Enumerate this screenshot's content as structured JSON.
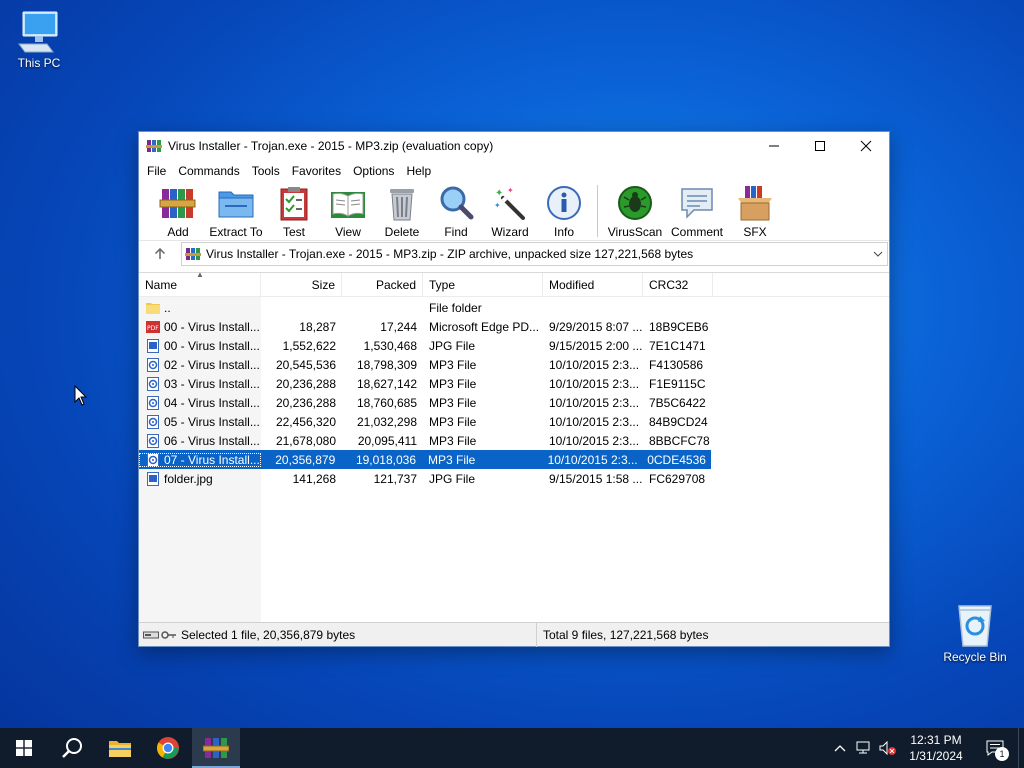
{
  "desktop": {
    "icons": [
      {
        "label": "This PC",
        "icon": "computer-icon"
      },
      {
        "label": "Recycle Bin",
        "icon": "recycle-bin-icon"
      }
    ]
  },
  "window": {
    "title": "Virus Installer - Trojan.exe - 2015 - MP3.zip (evaluation copy)",
    "menu": [
      "File",
      "Commands",
      "Tools",
      "Favorites",
      "Options",
      "Help"
    ],
    "toolbar": [
      {
        "label": "Add",
        "icon": "books-add-icon"
      },
      {
        "label": "Extract To",
        "icon": "folder-extract-icon"
      },
      {
        "label": "Test",
        "icon": "clipboard-test-icon"
      },
      {
        "label": "View",
        "icon": "book-view-icon"
      },
      {
        "label": "Delete",
        "icon": "trash-icon"
      },
      {
        "label": "Find",
        "icon": "magnifier-icon"
      },
      {
        "label": "Wizard",
        "icon": "magic-wand-icon"
      },
      {
        "label": "Info",
        "icon": "info-icon"
      },
      {
        "label": "VirusScan",
        "icon": "bug-scan-icon"
      },
      {
        "label": "Comment",
        "icon": "comment-icon"
      },
      {
        "label": "SFX",
        "icon": "box-sfx-icon"
      }
    ],
    "address": "Virus Installer - Trojan.exe - 2015 - MP3.zip - ZIP archive, unpacked size 127,221,568 bytes",
    "columns": {
      "name": "Name",
      "size": "Size",
      "packed": "Packed",
      "type": "Type",
      "modified": "Modified",
      "crc": "CRC32"
    },
    "files": [
      {
        "name": "..",
        "size": "",
        "packed": "",
        "type": "File folder",
        "modified": "",
        "crc": "",
        "icon": "folder-icon",
        "selected": false
      },
      {
        "name": "00 - Virus Install...",
        "size": "18,287",
        "packed": "17,244",
        "type": "Microsoft Edge PD...",
        "modified": "9/29/2015 8:07 ...",
        "crc": "18B9CEB6",
        "icon": "pdf-icon",
        "selected": false
      },
      {
        "name": "00 - Virus Install...",
        "size": "1,552,622",
        "packed": "1,530,468",
        "type": "JPG File",
        "modified": "9/15/2015 2:00 ...",
        "crc": "7E1C1471",
        "icon": "image-icon",
        "selected": false
      },
      {
        "name": "02 - Virus Install...",
        "size": "20,545,536",
        "packed": "18,798,309",
        "type": "MP3 File",
        "modified": "10/10/2015 2:3...",
        "crc": "F4130586",
        "icon": "audio-icon",
        "selected": false
      },
      {
        "name": "03 - Virus Install...",
        "size": "20,236,288",
        "packed": "18,627,142",
        "type": "MP3 File",
        "modified": "10/10/2015 2:3...",
        "crc": "F1E9115C",
        "icon": "audio-icon",
        "selected": false
      },
      {
        "name": "04 - Virus Install...",
        "size": "20,236,288",
        "packed": "18,760,685",
        "type": "MP3 File",
        "modified": "10/10/2015 2:3...",
        "crc": "7B5C6422",
        "icon": "audio-icon",
        "selected": false
      },
      {
        "name": "05 - Virus Install...",
        "size": "22,456,320",
        "packed": "21,032,298",
        "type": "MP3 File",
        "modified": "10/10/2015 2:3...",
        "crc": "84B9CD24",
        "icon": "audio-icon",
        "selected": false
      },
      {
        "name": "06 - Virus Install...",
        "size": "21,678,080",
        "packed": "20,095,411",
        "type": "MP3 File",
        "modified": "10/10/2015 2:3...",
        "crc": "8BBCFC78",
        "icon": "audio-icon",
        "selected": false
      },
      {
        "name": "07 - Virus Install...",
        "size": "20,356,879",
        "packed": "19,018,036",
        "type": "MP3 File",
        "modified": "10/10/2015 2:3...",
        "crc": "0CDE4536",
        "icon": "audio-icon",
        "selected": true
      },
      {
        "name": "folder.jpg",
        "size": "141,268",
        "packed": "121,737",
        "type": "JPG File",
        "modified": "9/15/2015 1:58 ...",
        "crc": "FC629708",
        "icon": "image-icon",
        "selected": false
      }
    ],
    "status": {
      "left": "Selected 1 file, 20,356,879 bytes",
      "right": "Total 9 files, 127,221,568 bytes"
    }
  },
  "taskbar": {
    "apps": [
      "start-icon",
      "search-icon",
      "file-explorer-icon",
      "chrome-icon",
      "winrar-icon"
    ],
    "time": "12:31 PM",
    "date": "1/31/2024",
    "notification_count": "1"
  },
  "colors": {
    "selection": "#0a64c8",
    "taskbar": "#101c2c"
  }
}
